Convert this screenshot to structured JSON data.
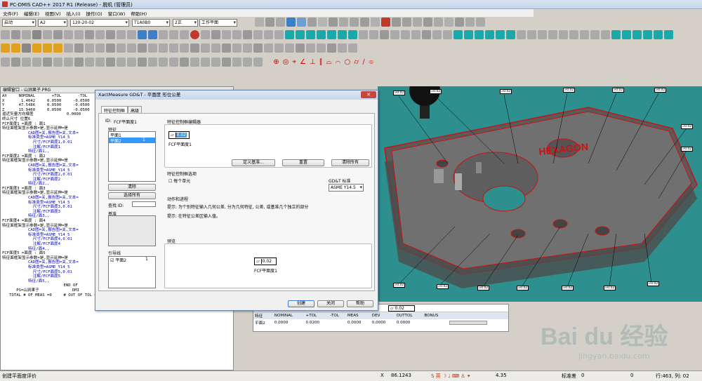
{
  "window": {
    "title": "PC-DMIS CAD++ 2017 R1 (Release) - 脱机 (管理员)"
  },
  "menu": [
    "文件(F)",
    "编辑(E)",
    "视图(V)",
    "插入(I)",
    "操作(O)",
    "窗口(W)",
    "帮助(H)"
  ],
  "toolbar": {
    "combos": [
      "启动",
      "A2",
      "120-20-02",
      "T1A0B0",
      "2正",
      "工作平面"
    ]
  },
  "editor": {
    "title": "编辑窗口 - 山涧果子.PRG",
    "lines": [
      "AX     NOMINAL       +TOL       -TOL",
      "X       1.4042     0.0500     -0.0500",
      "Y      47.5486     0.0500     -0.0500",
      "Z      15.9460     0.0500     -0.0500",
      "逼近矢量方向偏差              0.0000",
      "终止尺寸 位置6",
      "FCF面度1 =面度 : 面1",
      "特征面框架显示参数=是,显示延伸=是",
      "           CAD图=关,报告图=关,文本=",
      "           标准类型=ASME_Y14_5",
      "             尺寸/FCF面度1,0.01",
      "             注解/FCF面度1",
      "           特征/面1,,",
      "FCF面度2 =面度 : 面2",
      "特征面框架显示参数=是,显示延伸=是",
      "           CAD图=关,报告图=关,文本=",
      "           标准类型=ASME_Y14_5",
      "             尺寸/FCF面度2,0.01",
      "             注解/FCF面度2",
      "           特征/面2,,",
      "FCF面度3 =面度 : 面3",
      "特征面框架显示参数=是,显示延伸=是",
      "           CAD图=关,报告图=关,文本=",
      "           标准类型=ASME_Y14_5",
      "             尺寸/FCF面度3,0.01",
      "             注解/FCF面度3",
      "           特征/面3,,",
      "FCF面度4 =面度 : 面4",
      "特征面框架显示参数=是,显示延伸=是",
      "           CAD图=关,报告图=关,文本=",
      "           标准类型=ASME_Y14_5",
      "             尺寸/FCF面度4,0.01",
      "             注解/FCF面度4",
      "           特征/面4,,",
      "FCF面度5 =面度 : 面5",
      "特征面框架显示参数=是,显示延伸=是",
      "           CAD图=关,报告图=关,文本=",
      "           标准类型=ASME_Y14_5",
      "             尺寸/FCF面度5,0.01",
      "             注解/FCF面度5",
      "           特征/面5,,",
      "",
      "                          END OF",
      "      PS=山涧果子              DMI",
      "   TOTAL # OF MEAS =0     # OUT OF TOL =0     # OF HOURS =00:00:15"
    ]
  },
  "dialog": {
    "title": "XactMeasure GD&T - 平面度 形位公差",
    "tabs": [
      "特征控制框",
      "高级"
    ],
    "id_label": "ID:",
    "id_value": "FCF平面度1",
    "feature_label": "特征",
    "features": [
      {
        "name": "平面1",
        "n": ""
      },
      {
        "name": "平面2",
        "n": "1"
      }
    ],
    "clear_btn": "清除",
    "select_all_btn": "选择所有",
    "search_label": "查找 ID:",
    "datum_label": "基准",
    "leader_label": "引导线",
    "leader_item": "平面2",
    "leader_n": "1",
    "editor_label": "特征控制框编辑器",
    "fcf_value": "0.02",
    "fcf_caption": "FCF平面度1",
    "define_datum_btn": "定义基准...",
    "reset_btn": "重置",
    "clear_all_btn": "清除所有",
    "options_label": "特征控制框选项",
    "each_unit": "每个单元",
    "gdt_std_label": "GD&T 标准",
    "gdt_std_value": "ASME Y14.5",
    "notes_label": "动作和进程",
    "note1": "提示: 为个别特征输入几何公差, 分为几何特征, 公差, 或基准几个独立的部分",
    "note2": "提示: 在特征公差区输入值。",
    "preview_label": "预览",
    "preview_value": "0.02",
    "preview_caption": "FCF平面度1",
    "create_btn": "创建",
    "close_btn": "关闭",
    "help_btn": "帮助"
  },
  "report": {
    "fcf_value": "0.02",
    "headers": [
      "特征",
      "NOMINAL",
      "+TOL",
      "-TOL",
      "MEAS",
      "DEV",
      "OUTTOL",
      "BONUS"
    ],
    "row": [
      "平面2",
      "0.0000",
      "0.0200",
      "",
      "0.0000",
      "0.0000",
      "0.0000",
      ""
    ]
  },
  "status": {
    "text": "创建平面度评价",
    "x_label": "X",
    "x_value": "86.1243",
    "y_value": "4.35",
    "std_label": "标准差",
    "std_value": "0",
    "zero": "0",
    "line_info": "行:463, 列: 02"
  },
  "watermark": {
    "text1": "Bai du 经验",
    "text2": "jingyan.baidu.com"
  },
  "colors": {
    "accent": "#0000c0",
    "viewport_bg": "#2e8f8f",
    "part_red": "#cc1111"
  }
}
